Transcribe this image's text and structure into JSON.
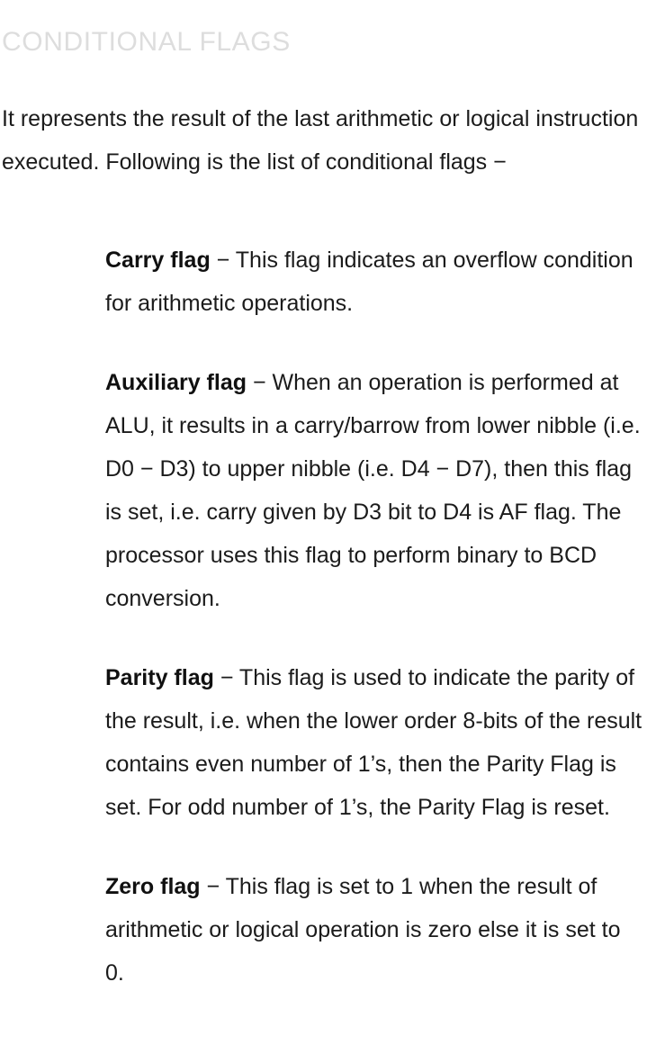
{
  "heading": "CONDITIONAL FLAGS",
  "intro": "It represents the result of the last arithmetic or logical instruction executed. Following is the list of conditional flags −",
  "dash": "−",
  "colors": {
    "heading": "#dddddd",
    "body_text": "#1b1b1b",
    "background": "#ffffff"
  },
  "flags": [
    {
      "term": "Carry flag",
      "description": "This flag indicates an overflow condition for arithmetic operations."
    },
    {
      "term": "Auxiliary flag",
      "description": "When an operation is performed at ALU, it results in a carry/barrow from lower nibble (i.e. D0 − D3) to upper nibble (i.e. D4 − D7), then this flag is set, i.e. carry given by D3 bit to D4 is AF flag. The processor uses this flag to perform binary to BCD conversion."
    },
    {
      "term": "Parity flag",
      "description": "This flag is used to indicate the parity of the result, i.e. when the lower order 8-bits of the result contains even number of 1’s, then the Parity Flag is set. For odd number of 1’s, the Parity Flag is reset."
    },
    {
      "term": "Zero flag",
      "description": "This flag is set to 1 when the result of arithmetic or logical operation is zero else it is set to 0."
    }
  ]
}
